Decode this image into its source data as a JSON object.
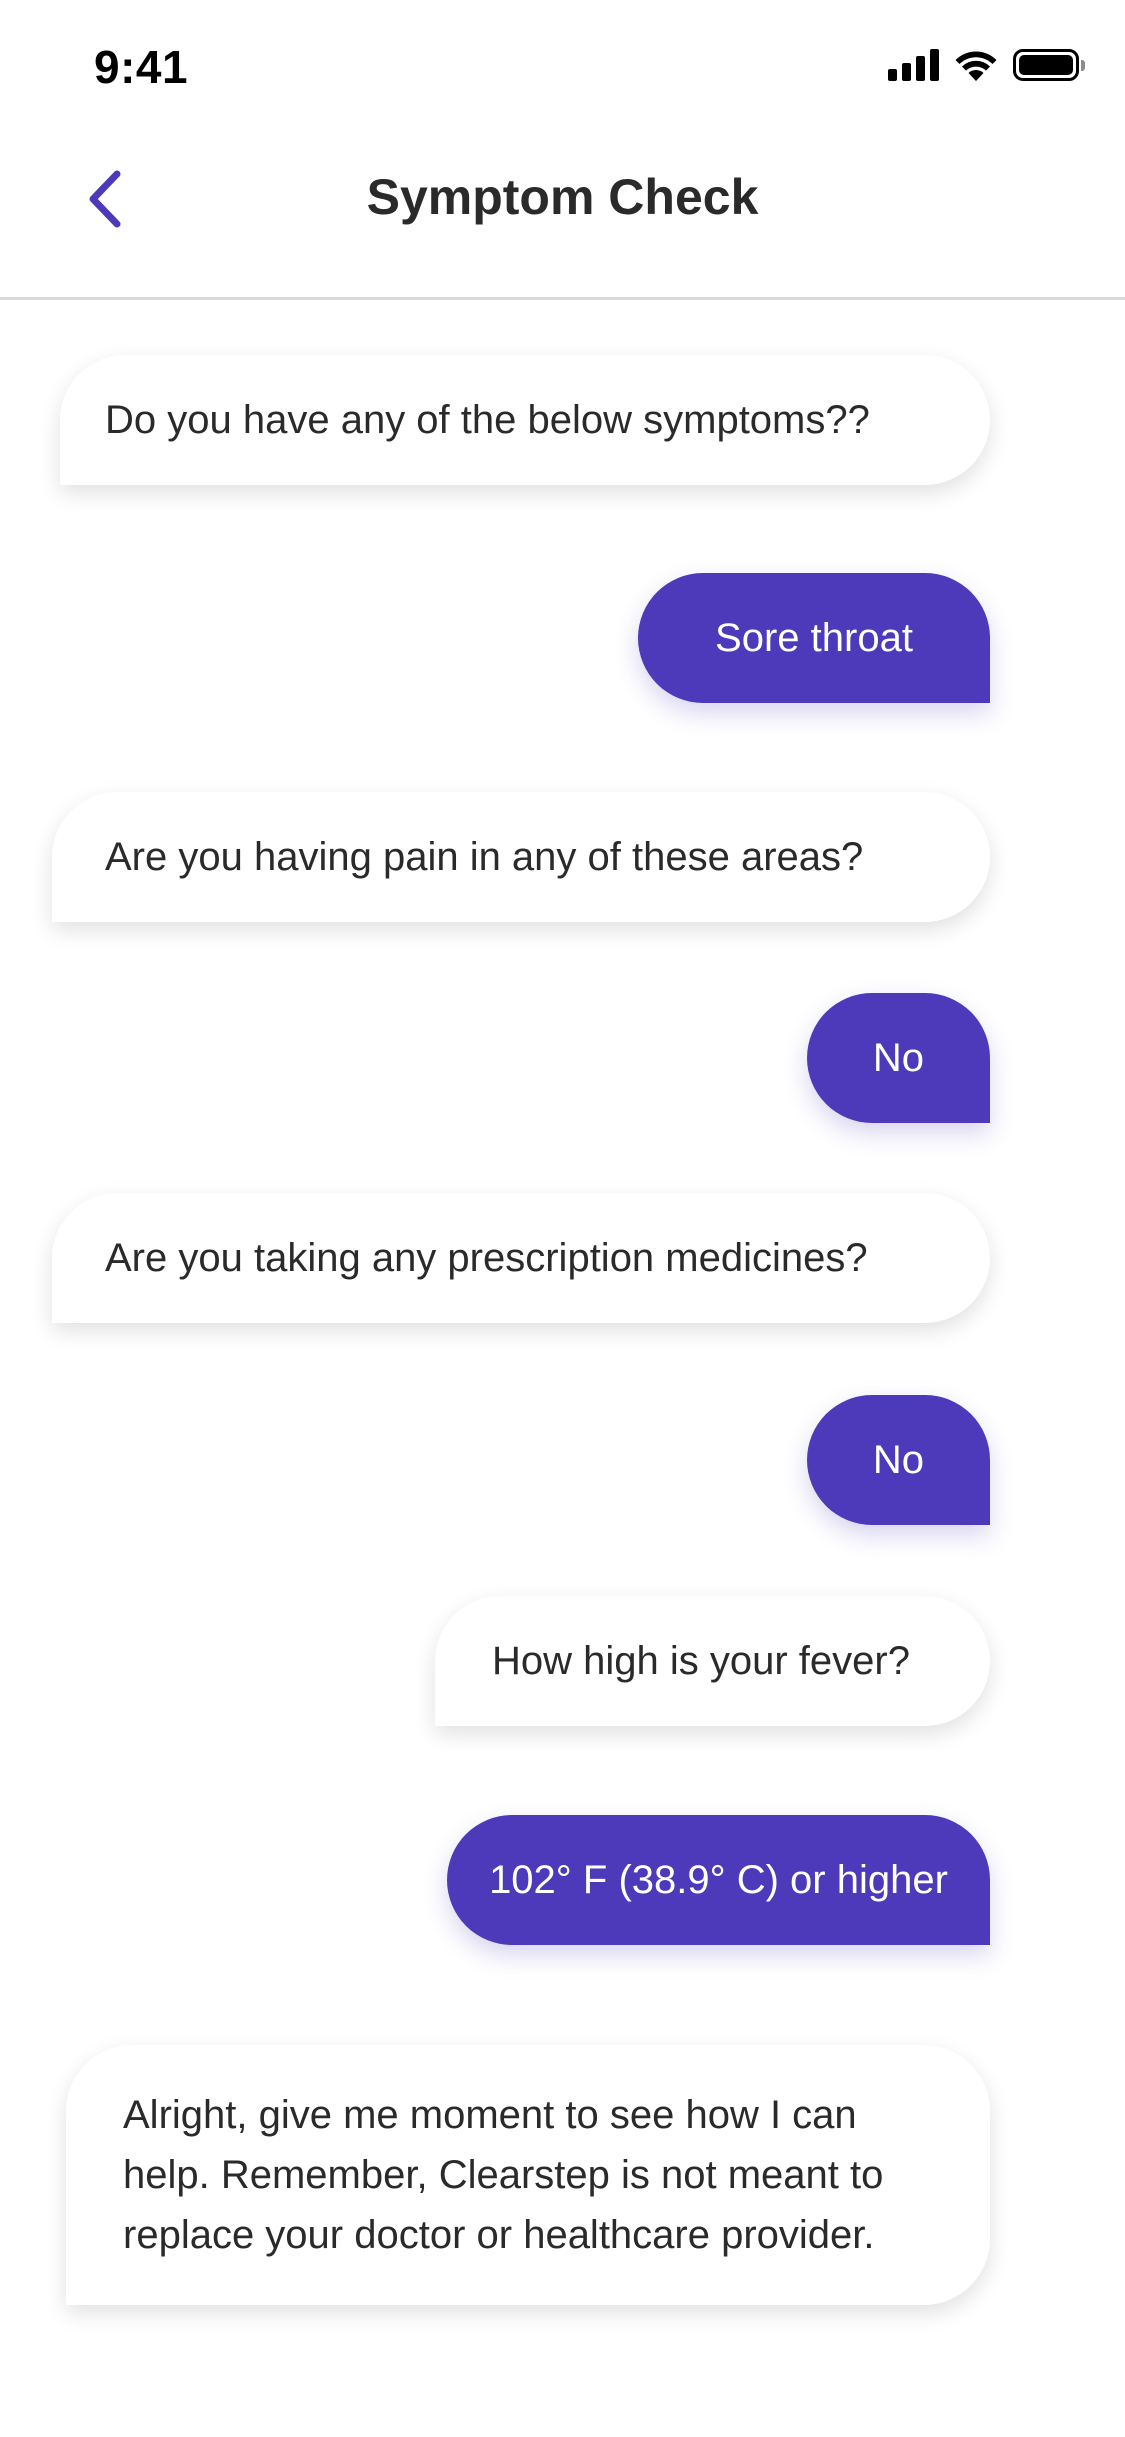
{
  "status_bar": {
    "time": "9:41",
    "icons": [
      "signal-icon",
      "wifi-icon",
      "battery-icon"
    ]
  },
  "header": {
    "title": "Symptom Check",
    "back_icon": "chevron-left-icon"
  },
  "colors": {
    "accent": "#4d3abb",
    "bot_bubble": "#ffffff",
    "text": "#2a2a2a"
  },
  "messages": [
    {
      "sender": "bot",
      "text": "Do you have any of the below symptoms??"
    },
    {
      "sender": "user",
      "text": "Sore throat"
    },
    {
      "sender": "bot",
      "text": "Are you having pain in any of these areas?"
    },
    {
      "sender": "user",
      "text": "No"
    },
    {
      "sender": "bot",
      "text": "Are you taking any prescription medicines?"
    },
    {
      "sender": "user",
      "text": "No"
    },
    {
      "sender": "bot",
      "text": "How high is your fever?"
    },
    {
      "sender": "user",
      "text": "102° F (38.9° C) or higher"
    },
    {
      "sender": "bot",
      "text": "Alright, give me moment to see how I can help. Remember, Clearstep is not meant to replace your doctor or healthcare provider."
    }
  ]
}
